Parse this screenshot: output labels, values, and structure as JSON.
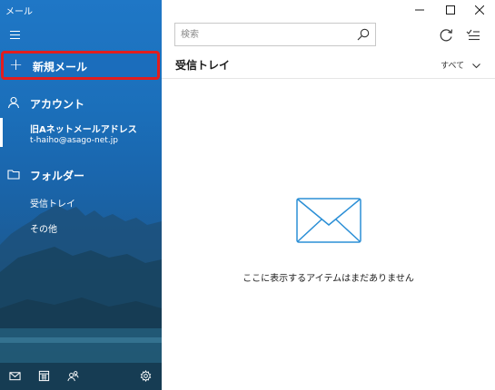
{
  "app": {
    "title": "メール"
  },
  "sidebar": {
    "new_mail_label": "新規メール",
    "accounts_heading": "アカウント",
    "account": {
      "name": "旧Aネットメールアドレス",
      "email": "t-haiho@asago-net.jp"
    },
    "folders_heading": "フォルダー",
    "folders": [
      {
        "label": "受信トレイ"
      },
      {
        "label": "その他"
      }
    ],
    "bottom_icons": [
      "mail-icon",
      "calendar-icon",
      "people-icon",
      "settings-icon"
    ]
  },
  "toolbar": {
    "search_placeholder": "検索"
  },
  "mail_list": {
    "title": "受信トレイ",
    "filter_label": "すべて",
    "empty_message": "ここに表示するアイテムはまだありません"
  },
  "colors": {
    "accent": "#1b6dbc",
    "highlight_border": "#e31d1d",
    "empty_icon": "#2b8fd6"
  }
}
